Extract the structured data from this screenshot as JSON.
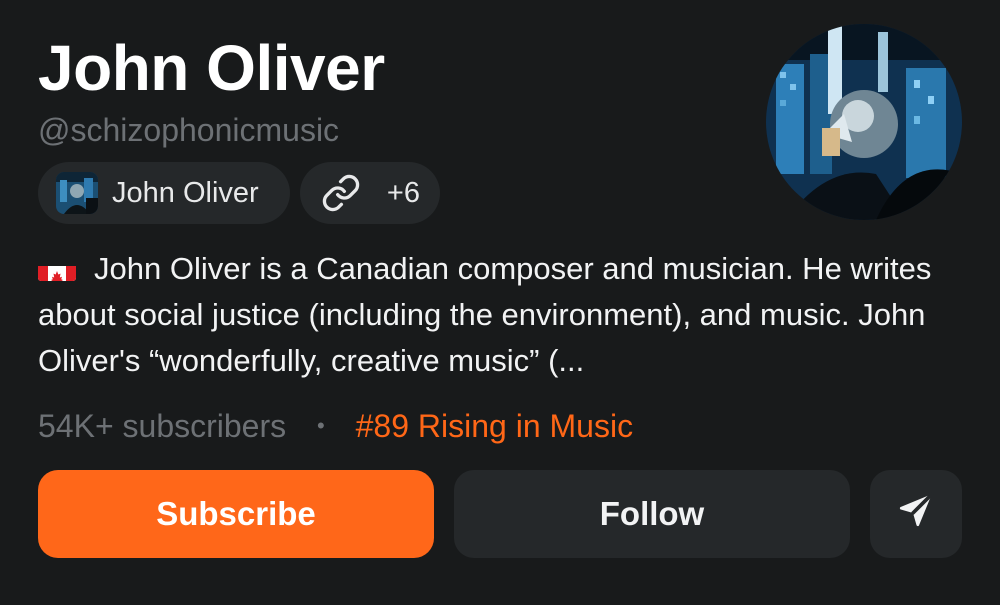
{
  "profile": {
    "name": "John Oliver",
    "handle": "@schizophonicmusic",
    "chip_name": "John Oliver",
    "links_count": "+6",
    "bio": "John Oliver is a Canadian composer and musician. He writes about social justice (including the environment), and music. John Oliver's “wonderfully, creative music” (...",
    "bio_flag_icon": "canada-flag-icon"
  },
  "stats": {
    "subscribers": "54K+ subscribers",
    "separator": "•",
    "rank": "#89 Rising in Music"
  },
  "actions": {
    "subscribe_label": "Subscribe",
    "follow_label": "Follow",
    "share_icon": "send-icon"
  },
  "colors": {
    "background": "#181a1b",
    "accent": "#ff6719",
    "muted_text": "#6d7175",
    "chip_background": "#25282a"
  }
}
